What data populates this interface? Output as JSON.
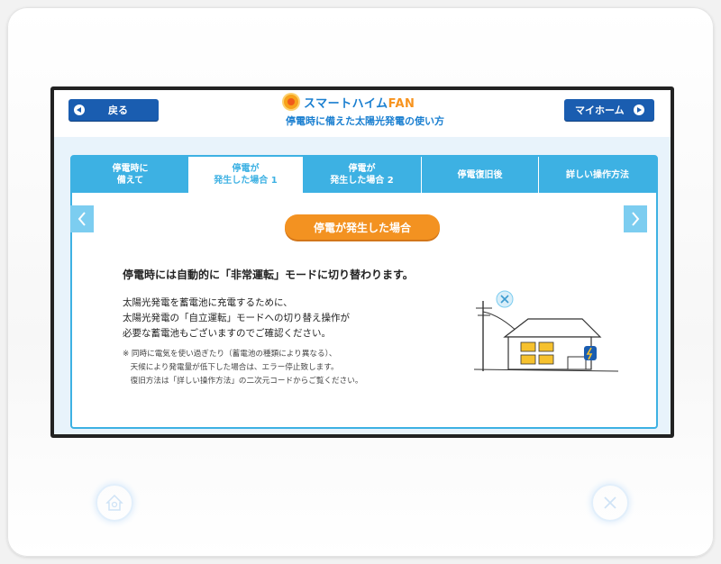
{
  "header": {
    "back_label": "戻る",
    "home_label": "マイホーム",
    "app_name_main": "スマートハイム",
    "app_name_accent": "FAN",
    "subtitle": "停電時に備えた太陽光発電の使い方"
  },
  "tabs": [
    {
      "label": "停電時に\n備えて",
      "active": false
    },
    {
      "label": "停電が\n発生した場合 1",
      "active": true
    },
    {
      "label": "停電が\n発生した場合 2",
      "active": false
    },
    {
      "label": "停電復旧後",
      "active": false
    },
    {
      "label": "詳しい操作方法",
      "active": false
    }
  ],
  "content": {
    "badge": "停電が発生した場合",
    "headline": "停電時には自動的に「非常運転」モードに切り替わります。",
    "body_lines": [
      "太陽光発電を蓄電池に充電するために、",
      "太陽光発電の「自立運転」モードへの切り替え操作が",
      "必要な蓄電池もございますのでご確認ください。"
    ],
    "note_lines": [
      "※ 同時に電気を使い過ぎたり（蓄電池の種類により異なる）、",
      "　天候により発電量が低下した場合は、エラー停止致します。",
      "　復旧方法は「詳しい操作方法」の二次元コードからご覧ください。"
    ]
  },
  "colors": {
    "tab_blue": "#3db1e3",
    "button_blue": "#1a5db0",
    "badge_orange": "#f39221",
    "title_blue": "#1a7fd0"
  },
  "icons": [
    "chevron-left-icon",
    "chevron-right-icon",
    "sun-logo-icon",
    "house-illustration",
    "home-hardware-icon",
    "close-hardware-icon"
  ]
}
